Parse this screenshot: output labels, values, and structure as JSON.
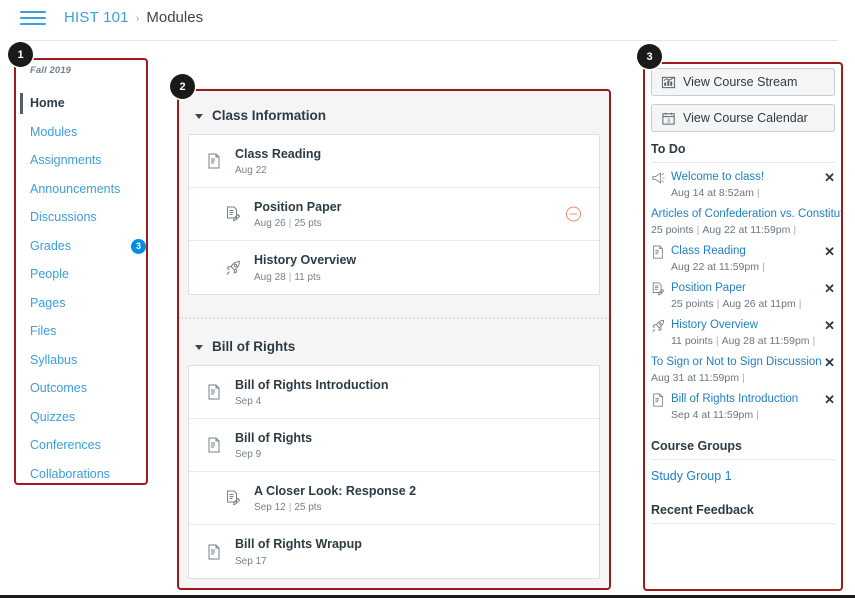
{
  "header": {
    "menu_icon": "hamburger-icon",
    "course": "HIST 101",
    "separator": "›",
    "current": "Modules"
  },
  "course_nav": {
    "term": "Fall 2019",
    "items": [
      {
        "label": "Home",
        "active": true
      },
      {
        "label": "Modules"
      },
      {
        "label": "Assignments"
      },
      {
        "label": "Announcements"
      },
      {
        "label": "Discussions"
      },
      {
        "label": "Grades",
        "badge": "3"
      },
      {
        "label": "People"
      },
      {
        "label": "Pages"
      },
      {
        "label": "Files"
      },
      {
        "label": "Syllabus"
      },
      {
        "label": "Outcomes"
      },
      {
        "label": "Quizzes"
      },
      {
        "label": "Conferences"
      },
      {
        "label": "Collaborations"
      }
    ]
  },
  "modules": [
    {
      "title": "Class Information",
      "items": [
        {
          "icon": "page-icon",
          "title": "Class Reading",
          "date": "Aug 22",
          "points": "",
          "indent": false,
          "status": ""
        },
        {
          "icon": "assignment-icon",
          "title": "Position Paper",
          "date": "Aug 26",
          "points": "25 pts",
          "indent": true,
          "status": "no-submission-icon"
        },
        {
          "icon": "quiz-icon",
          "title": "History Overview",
          "date": "Aug 28",
          "points": "11 pts",
          "indent": true,
          "status": ""
        }
      ]
    },
    {
      "title": "Bill of Rights",
      "items": [
        {
          "icon": "page-icon",
          "title": "Bill of Rights Introduction",
          "date": "Sep 4",
          "points": "",
          "indent": false,
          "status": ""
        },
        {
          "icon": "page-icon",
          "title": "Bill of Rights",
          "date": "Sep 9",
          "points": "",
          "indent": false,
          "status": ""
        },
        {
          "icon": "assignment-icon",
          "title": "A Closer Look: Response 2",
          "date": "Sep 12",
          "points": "25 pts",
          "indent": true,
          "status": ""
        },
        {
          "icon": "page-icon",
          "title": "Bill of Rights Wrapup",
          "date": "Sep 17",
          "points": "",
          "indent": false,
          "status": ""
        }
      ]
    }
  ],
  "sidebar": {
    "buttons": [
      {
        "icon": "course-stream-icon",
        "label": "View Course Stream"
      },
      {
        "icon": "course-calendar-icon",
        "label": "View Course Calendar"
      }
    ],
    "todo_heading": "To Do",
    "todo": [
      {
        "icon": "announcement-icon",
        "title": "Welcome to class!",
        "points": "",
        "due": "Aug 14 at 8:52am",
        "dismissable": true
      },
      {
        "icon": "",
        "title": "Articles of Confederation vs. Constitution",
        "points": "25 points",
        "due": "Aug 22 at 11:59pm",
        "dismissable": false
      },
      {
        "icon": "page-icon",
        "title": "Class Reading",
        "points": "",
        "due": "Aug 22 at 11:59pm",
        "dismissable": true
      },
      {
        "icon": "assignment-icon",
        "title": "Position Paper",
        "points": "25 points",
        "due": "Aug 26 at 11pm",
        "dismissable": true
      },
      {
        "icon": "quiz-icon",
        "title": "History Overview",
        "points": "11 points",
        "due": "Aug 28 at 11:59pm",
        "dismissable": true
      },
      {
        "icon": "",
        "title": "To Sign or Not to Sign Discussion",
        "points": "",
        "due": "Aug 31 at 11:59pm",
        "dismissable": true
      },
      {
        "icon": "page-icon",
        "title": "Bill of Rights Introduction",
        "points": "",
        "due": "Sep 4 at 11:59pm",
        "dismissable": true
      }
    ],
    "groups_heading": "Course Groups",
    "groups": [
      {
        "label": "Study Group 1"
      }
    ],
    "feedback_heading": "Recent Feedback"
  },
  "annotations": [
    {
      "number": "1",
      "target": "course-navigation"
    },
    {
      "number": "2",
      "target": "modules-list"
    },
    {
      "number": "3",
      "target": "course-sidebar"
    }
  ],
  "colors": {
    "link": "#3b9fdc",
    "annotation": "#9e1b1b",
    "badge": "#008ee2",
    "warning": "#f08a6c"
  }
}
